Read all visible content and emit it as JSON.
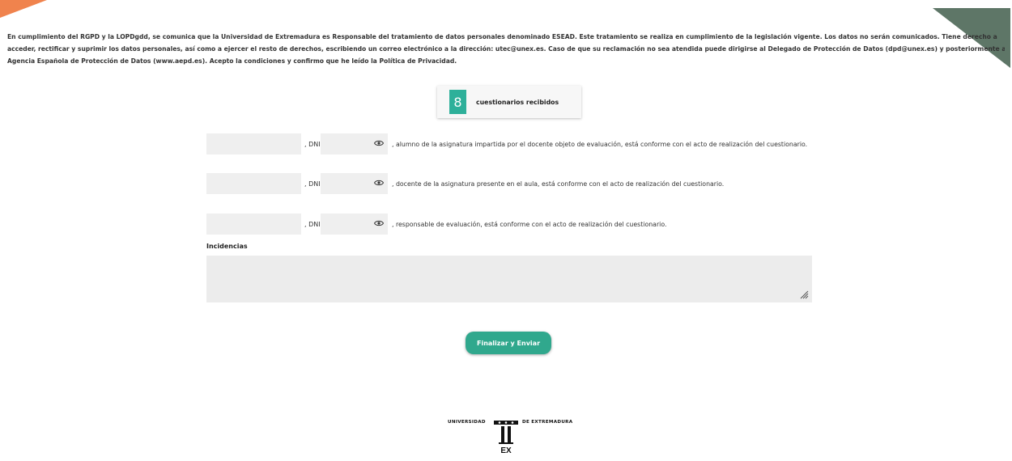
{
  "privacy": {
    "line1": "En cumplimiento del RGPD y la LOPDgdd, se comunica que la Universidad de Extremadura es Responsable del tratamiento de datos personales denominado ESEAD. Este tratamiento se realiza en cumplimiento de la legislación vigente. Los datos no serán comunicados. Tiene derecho a",
    "line2": "acceder, rectificar y suprimir los datos personales, así como a ejercer el resto de derechos, escribiendo un correo electrónico a la dirección: utec@unex.es. Caso de que su reclamación no sea atendida puede dirigirse al Delegado de Protección de Datos (dpd@unex.es) y posteriormente a la",
    "line3": "Agencia Española de Protección de Datos (www.aepd.es). Acepto la condiciones y confirmo que he leído la Política de Privacidad."
  },
  "counter": {
    "value": "8",
    "label": "cuestionarios recibidos"
  },
  "rows": [
    {
      "dni_label": ", DNI",
      "text": ", alumno de la asignatura impartida por el docente objeto de evaluación, está conforme con el acto de realización del cuestionario."
    },
    {
      "dni_label": ", DNI",
      "text": ", docente de la asignatura presente en el aula, está conforme con el acto de realización del cuestionario."
    },
    {
      "dni_label": ", DNI",
      "text": ", responsable de evaluación, está conforme con el acto de realización del cuestionario."
    }
  ],
  "incidencias": {
    "label": "Incidencias",
    "value": ""
  },
  "submit": {
    "label": "Finalizar y Enviar"
  },
  "logo": {
    "left_text": "UNIVERSIDAD",
    "right_text": "DE EXTREMADURA",
    "mark_text": "EX"
  },
  "colors": {
    "accent": "#30a88d",
    "corner_left": "#f0834d",
    "corner_right": "#5e7667"
  }
}
